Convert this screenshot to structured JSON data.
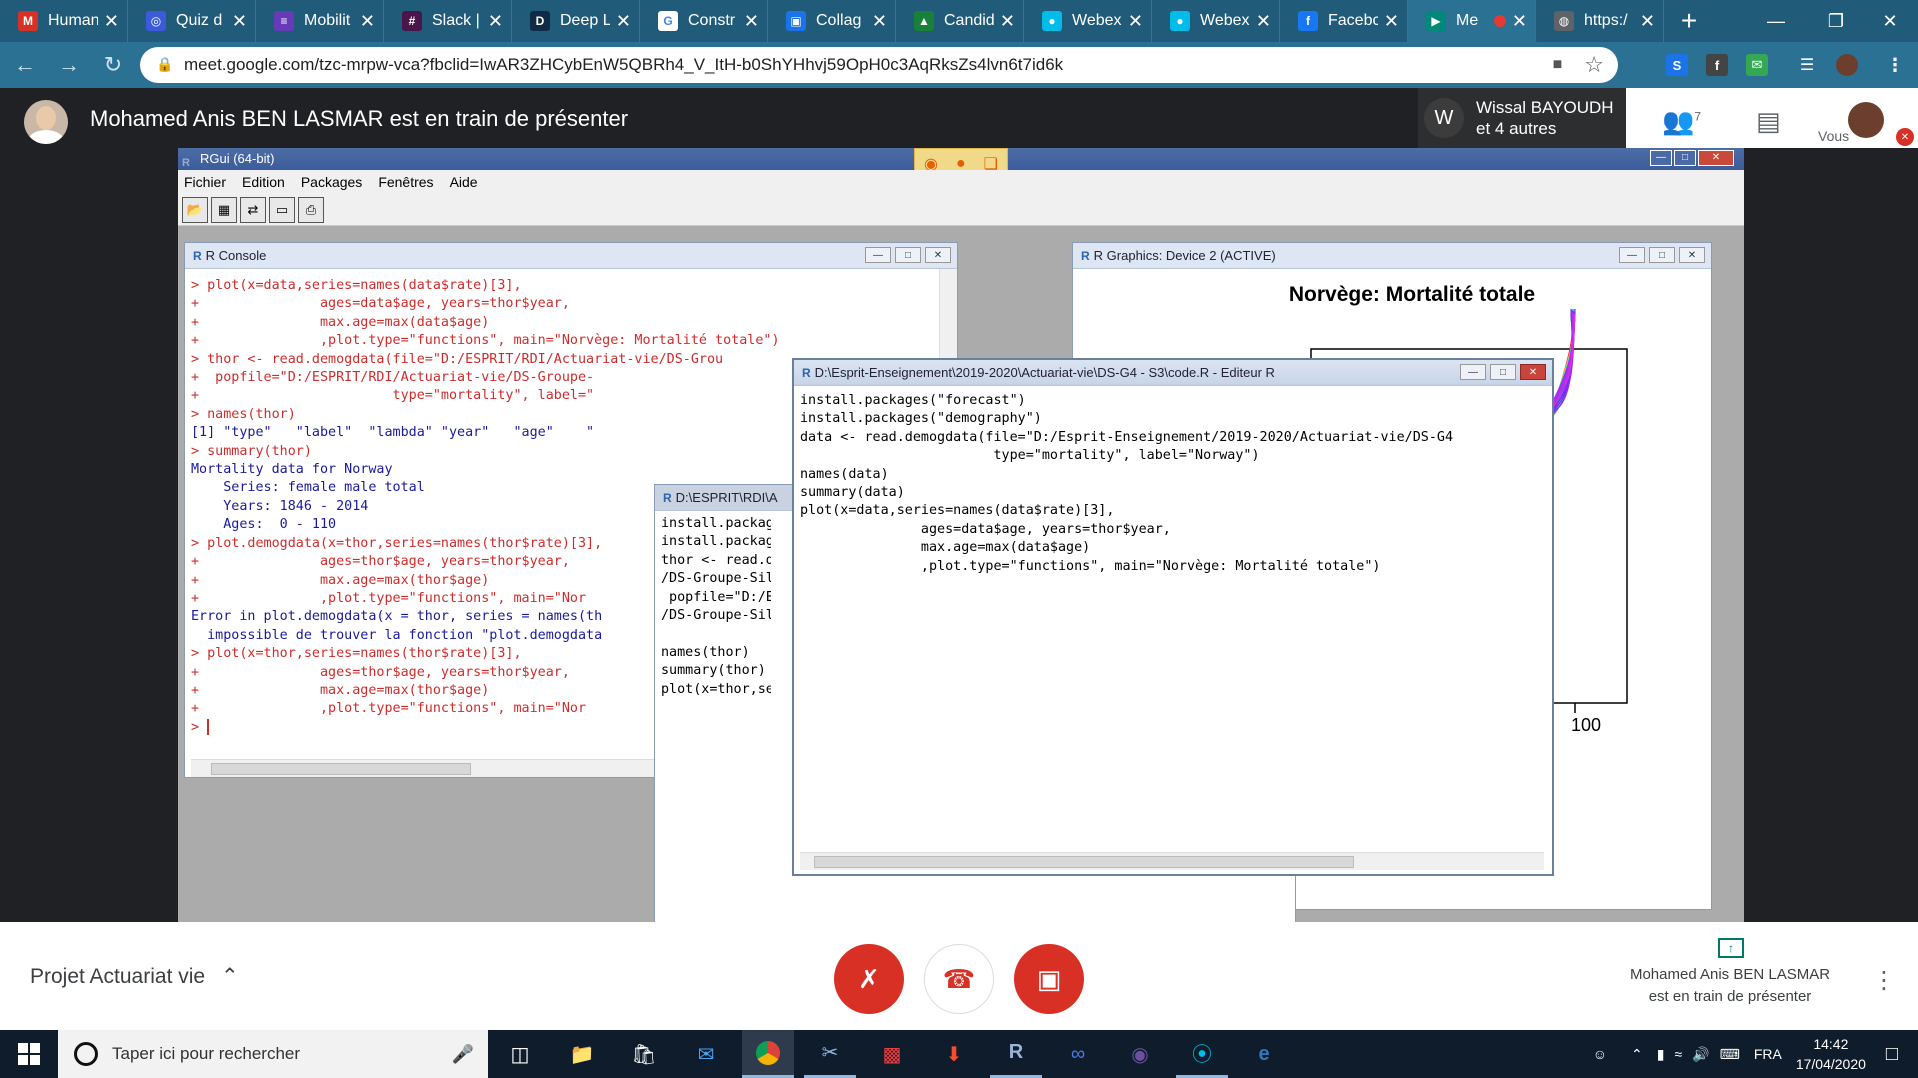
{
  "browser": {
    "tabs": [
      {
        "label": "Human",
        "icon": "gmail-icon",
        "color": "#d93025",
        "glyph": "M"
      },
      {
        "label": "Quiz d",
        "icon": "globe-icon",
        "color": "#3b5bdb",
        "glyph": "◎"
      },
      {
        "label": "Mobilit",
        "icon": "form-icon",
        "color": "#673ab7",
        "glyph": "≡"
      },
      {
        "label": "Slack |",
        "icon": "slack-icon",
        "color": "#4a154b",
        "glyph": "#"
      },
      {
        "label": "Deep L",
        "icon": "deepl-icon",
        "color": "#0f2b46",
        "glyph": "D"
      },
      {
        "label": "Constr",
        "icon": "google-icon",
        "color": "#ffffff",
        "glyph": "G"
      },
      {
        "label": "Collag",
        "icon": "person-icon",
        "color": "#1a73e8",
        "glyph": "▣"
      },
      {
        "label": "Candid",
        "icon": "drive-icon",
        "color": "#188038",
        "glyph": "▲"
      },
      {
        "label": "Webex",
        "icon": "webex-icon",
        "color": "#00bceb",
        "glyph": "●"
      },
      {
        "label": "Webex",
        "icon": "webex-icon",
        "color": "#00bceb",
        "glyph": "●"
      },
      {
        "label": "Facebc",
        "icon": "facebook-icon",
        "color": "#1877f2",
        "glyph": "f"
      },
      {
        "label": "Me",
        "icon": "meet-icon",
        "color": "#00897b",
        "glyph": "▶",
        "active": true
      },
      {
        "label": "https:/",
        "icon": "globe-icon",
        "color": "#5f6368",
        "glyph": "◍"
      }
    ],
    "url": "meet.google.com/tzc-mrpw-vca?fbclid=IwAR3ZHCybEnW5QBRh4_V_ItH-b0ShYHhvj59OpH0c3AqRksZs4lvn6t7id6k"
  },
  "meet": {
    "presenter_title": "Mohamed Anis BEN LASMAR est en train de présenter",
    "participant_name": "Wissal BAYOUDH",
    "participant_others": "et 4 autres",
    "participant_initial": "W",
    "people_count": "7",
    "self_label": "Vous",
    "meeting_name": "Projet Actuariat vie",
    "presenting_status": "Mohamed Anis BEN LASMAR est en train de présenter"
  },
  "rgui": {
    "title": "RGui (64-bit)",
    "menu": [
      "Fichier",
      "Edition",
      "Packages",
      "Fenêtres",
      "Aide"
    ],
    "console_title": "R Console",
    "console_lines": [
      {
        "t": "> plot(x=data,series=names(data$rate)[3],",
        "c": "red"
      },
      {
        "t": "+               ages=data$age, years=thor$year,",
        "c": "red"
      },
      {
        "t": "+               max.age=max(data$age)",
        "c": "red"
      },
      {
        "t": "+               ,plot.type=\"functions\", main=\"Norvège: Mortalité totale\")",
        "c": "red"
      },
      {
        "t": "> thor <- read.demogdata(file=\"D:/ESPRIT/RDI/Actuariat-vie/DS-Grou",
        "c": "red"
      },
      {
        "t": "+  popfile=\"D:/ESPRIT/RDI/Actuariat-vie/DS-Groupe-",
        "c": "red"
      },
      {
        "t": "+                        type=\"mortality\", label=\"",
        "c": "red"
      },
      {
        "t": "> names(thor)",
        "c": "red"
      },
      {
        "t": "[1] \"type\"   \"label\"  \"lambda\" \"year\"   \"age\"    \"",
        "c": "blue"
      },
      {
        "t": "> summary(thor)",
        "c": "red"
      },
      {
        "t": "Mortality data for Norway",
        "c": "blue"
      },
      {
        "t": "    Series: female male total",
        "c": "blue"
      },
      {
        "t": "    Years: 1846 - 2014",
        "c": "blue"
      },
      {
        "t": "    Ages:  0 - 110",
        "c": "blue"
      },
      {
        "t": "> plot.demogdata(x=thor,series=names(thor$rate)[3],",
        "c": "red"
      },
      {
        "t": "+               ages=thor$age, years=thor$year,",
        "c": "red"
      },
      {
        "t": "+               max.age=max(thor$age)",
        "c": "red"
      },
      {
        "t": "+               ,plot.type=\"functions\", main=\"Nor",
        "c": "red"
      },
      {
        "t": "Error in plot.demogdata(x = thor, series = names(th",
        "c": "blue"
      },
      {
        "t": "  impossible de trouver la fonction \"plot.demogdata",
        "c": "blue"
      },
      {
        "t": "> plot(x=thor,series=names(thor$rate)[3],",
        "c": "red"
      },
      {
        "t": "+               ages=thor$age, years=thor$year,",
        "c": "red"
      },
      {
        "t": "+               max.age=max(thor$age)",
        "c": "red"
      },
      {
        "t": "+               ,plot.type=\"functions\", main=\"Nor",
        "c": "red"
      },
      {
        "t": "> ",
        "c": "red"
      }
    ],
    "graphics_title": "R Graphics: Device 2 (ACTIVE)",
    "plot_title": "Norvège: Mortalité totale",
    "plot_tick": "100",
    "editor2_title": "D:\\ESPRIT\\RDI\\A",
    "editor2_lines": [
      "install.packag",
      "install.packag",
      "thor <- read.d",
      "/DS-Groupe-Sil",
      " popfile=\"D:/E",
      "/DS-Groupe-Sil",
      "",
      "names(thor)",
      "summary(thor)",
      "plot(x=thor,se"
    ],
    "editor_title": "D:\\Esprit-Enseignement\\2019-2020\\Actuariat-vie\\DS-G4 - S3\\code.R - Editeur R",
    "editor_lines": [
      "install.packages(\"forecast\")",
      "install.packages(\"demography\")",
      "data <- read.demogdata(file=\"D:/Esprit-Enseignement/2019-2020/Actuariat-vie/DS-G4",
      "                        type=\"mortality\", label=\"Norway\")",
      "names(data)",
      "summary(data)",
      "plot(x=data,series=names(data$rate)[3],",
      "               ages=data$age, years=thor$year,",
      "               max.age=max(data$age)",
      "               ,plot.type=\"functions\", main=\"Norvège: Mortalité totale\")"
    ]
  },
  "taskbar": {
    "search_placeholder": "Taper ici pour rechercher",
    "language": "FRA",
    "time": "14:42",
    "date": "17/04/2020"
  },
  "colors": {
    "browser_tab_bg": "#215b7a",
    "meet_red": "#d93025",
    "r_prompt_red": "#d02c2c",
    "r_output_blue": "#1a1a9a"
  }
}
